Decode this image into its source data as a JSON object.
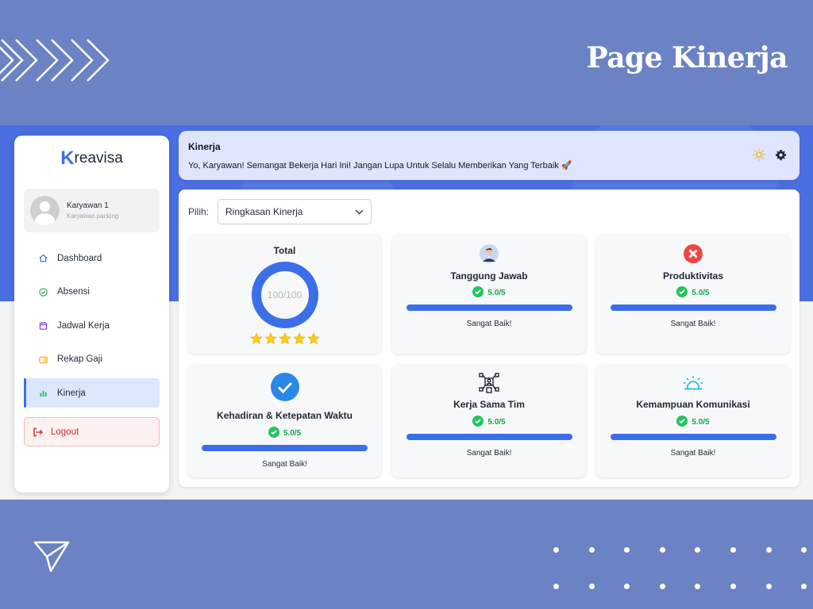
{
  "slide_title": "Page Kinerja",
  "brand": {
    "letter": "K",
    "rest": "reavisa"
  },
  "profile": {
    "name": "Karyawan 1",
    "role": "Karyawan packing"
  },
  "sidebar": {
    "items": [
      {
        "label": "Dashboard",
        "icon": "home-icon",
        "active": false
      },
      {
        "label": "Absensi",
        "icon": "check-circle-icon",
        "active": false
      },
      {
        "label": "Jadwal Kerja",
        "icon": "calendar-icon",
        "active": false
      },
      {
        "label": "Rekap Gaji",
        "icon": "wallet-icon",
        "active": false
      },
      {
        "label": "Kinerja",
        "icon": "bar-chart-icon",
        "active": true
      }
    ],
    "logout_label": "Logout"
  },
  "header": {
    "title": "Kinerja",
    "message": "Yo, Karyawan! Semangat Bekerja Hari Ini! Jangan Lupa Untuk Selalu Memberikan Yang Terbaik 🚀"
  },
  "picker": {
    "label": "Pilih:",
    "selected": "Ringkasan Kinerja"
  },
  "total": {
    "title": "Total",
    "value_text": "100/100",
    "progress": 1.0,
    "stars": 5
  },
  "metrics": [
    {
      "title": "Tanggung Jawab",
      "score": "5.0/5",
      "verdict": "Sangat Baik!",
      "icon": "person-icon",
      "fill": 1.0
    },
    {
      "title": "Produktivitas",
      "score": "5.0/5",
      "verdict": "Sangat Baik!",
      "icon": "x-circle-icon",
      "fill": 1.0
    },
    {
      "title": "Kehadiran & Ketepatan Waktu",
      "score": "5.0/5",
      "verdict": "Sangat Baik!",
      "icon": "check-badge-icon",
      "fill": 1.0
    },
    {
      "title": "Kerja Sama Tim",
      "score": "5.0/5",
      "verdict": "Sangat Baik!",
      "icon": "team-network-icon",
      "fill": 1.0
    },
    {
      "title": "Kemampuan Komunikasi",
      "score": "5.0/5",
      "verdict": "Sangat Baik!",
      "icon": "alarm-light-icon",
      "fill": 1.0
    }
  ],
  "colors": {
    "accent": "#3b6fe8",
    "success": "#16a34a",
    "danger": "#dc2626",
    "background": "#6b83c4"
  }
}
